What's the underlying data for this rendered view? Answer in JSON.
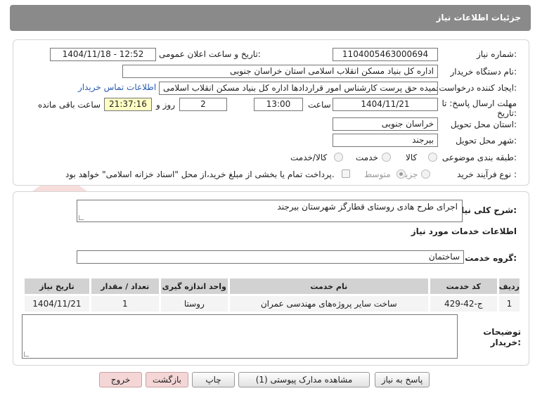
{
  "header": {
    "title": "جزئیات اطلاعات نیاز"
  },
  "fields": {
    "need_number_label": "شماره نیاز:",
    "need_number": "1104005463000694",
    "announce_label": "تاریخ و ساعت اعلان عمومی:",
    "announce_value": "1404/11/18 - 12:52",
    "buyer_org_label": "نام دستگاه خریدار:",
    "buyer_org": "اداره کل بنیاد مسکن انقلاب اسلامی استان خراسان جنوبی",
    "requester_label": "ایجاد کننده درخواست:",
    "requester": "حمیده حق پرست کارشناس امور قراردادها اداره کل بنیاد مسکن انقلاب اسلامی",
    "contact_link": "اطلاعات تماس خریدار",
    "deadline_label": "مهلت ارسال پاسخ: تا تاریخ:",
    "deadline_date": "1404/11/21",
    "time_label": "ساعت",
    "deadline_time": "13:00",
    "days_value": "2",
    "days_label": "روز و",
    "remaining_time": "21:37:16",
    "remaining_label": "ساعت باقی مانده",
    "province_label": "استان محل تحویل:",
    "province": "خراسان جنوبی",
    "city_label": "شهر محل تحویل:",
    "city": "بیرجند",
    "category_label": "طبقه بندی موضوعی:",
    "category_options": [
      "کالا",
      "خدمت",
      "کالا/خدمت"
    ],
    "process_label": "نوع فرآیند خرید :",
    "process_options": [
      "جزیی",
      "متوسط"
    ],
    "payment_note": "پرداخت تمام یا بخشی از مبلغ خرید،از محل \"اسناد خزانه اسلامی\" خواهد بود."
  },
  "summary": {
    "label": "شرح کلی نیاز:",
    "text": "اجرای طرح هادی روستای قطارگز شهرستان بیرجند"
  },
  "services": {
    "section_title": "اطلاعات خدمات مورد نیاز",
    "group_label": "گروه خدمت:",
    "group_value": "ساختمان",
    "columns": [
      "ردیف",
      "کد خدمت",
      "نام خدمت",
      "واحد اندازه گیری",
      "تعداد / مقدار",
      "تاریخ نیاز"
    ],
    "rows": [
      [
        "1",
        "ج-42-429",
        "ساخت سایر پروژه‌های مهندسی عمران",
        "روستا",
        "1",
        "1404/11/21"
      ]
    ]
  },
  "notes": {
    "label_line1": "توضیحات",
    "label_line2": "خریدار:",
    "text": ""
  },
  "buttons": {
    "reply": "پاسخ به نیاز",
    "attachments": "مشاهده مدارک پیوستی (1)",
    "print": "چاپ",
    "back": "بازگشت",
    "exit": "خروج"
  },
  "colors": {
    "header": "#8a8a8a",
    "link": "#2a5db0",
    "highlight": "#ffffc4",
    "pink_button": "#f4d6d6"
  }
}
